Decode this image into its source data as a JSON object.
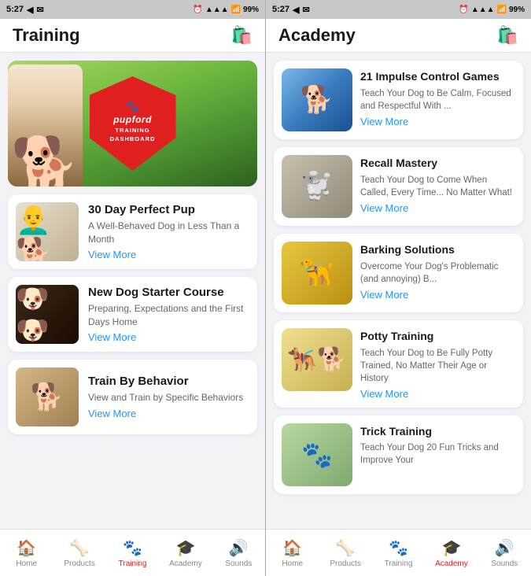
{
  "leftScreen": {
    "statusBar": {
      "time": "5:27",
      "battery": "99%"
    },
    "header": {
      "title": "Training",
      "icon": "bag"
    },
    "courses": [
      {
        "id": "30day",
        "title": "30 Day Perfect Pup",
        "desc": "A Well-Behaved Dog in Less Than a Month",
        "viewMore": "View More",
        "thumbType": "30day"
      },
      {
        "id": "newdog",
        "title": "New Dog Starter Course",
        "desc": "Preparing, Expectations and the First Days Home",
        "viewMore": "View More",
        "thumbType": "newdog"
      },
      {
        "id": "behavior",
        "title": "Train By Behavior",
        "desc": "View and Train by Specific Behaviors",
        "viewMore": "View More",
        "thumbType": "behavior"
      }
    ],
    "nav": [
      {
        "id": "home",
        "label": "Home",
        "icon": "🏠",
        "active": false
      },
      {
        "id": "products",
        "label": "Products",
        "icon": "🦴",
        "active": false
      },
      {
        "id": "training",
        "label": "Training",
        "icon": "🐾",
        "active": true
      },
      {
        "id": "academy",
        "label": "Academy",
        "icon": "🎓",
        "active": false
      },
      {
        "id": "sounds",
        "label": "Sounds",
        "icon": "🔊",
        "active": false
      }
    ],
    "shield": {
      "brand": "pupford",
      "line1": "TRAINING",
      "line2": "DASHBOARD"
    }
  },
  "rightScreen": {
    "statusBar": {
      "time": "5:27",
      "battery": "99%"
    },
    "header": {
      "title": "Academy",
      "icon": "bag"
    },
    "courses": [
      {
        "id": "impulse",
        "title": "21 Impulse Control Games",
        "desc": "Teach Your Dog to Be Calm, Focused and Respectful With ...",
        "viewMore": "View More",
        "thumbType": "impulse"
      },
      {
        "id": "recall",
        "title": "Recall Mastery",
        "desc": "Teach Your Dog to Come When Called, Every Time... No Matter What!",
        "viewMore": "View More",
        "thumbType": "recall"
      },
      {
        "id": "barking",
        "title": "Barking Solutions",
        "desc": "Overcome Your Dog's Problematic (and annoying) B...",
        "viewMore": "View More",
        "thumbType": "barking"
      },
      {
        "id": "potty",
        "title": "Potty Training",
        "desc": "Teach Your Dog to Be Fully Potty Trained, No Matter Their Age or History",
        "viewMore": "View More",
        "thumbType": "potty"
      },
      {
        "id": "trick",
        "title": "Trick Training",
        "desc": "Teach Your Dog 20 Fun Tricks and Improve Your",
        "viewMore": "View More",
        "thumbType": "trick"
      }
    ],
    "nav": [
      {
        "id": "home",
        "label": "Home",
        "icon": "🏠",
        "active": false
      },
      {
        "id": "products",
        "label": "Products",
        "icon": "🦴",
        "active": false
      },
      {
        "id": "training",
        "label": "Training",
        "icon": "🐾",
        "active": false
      },
      {
        "id": "academy",
        "label": "Academy",
        "icon": "🎓",
        "active": true
      },
      {
        "id": "sounds",
        "label": "Sounds",
        "icon": "🔊",
        "active": false
      }
    ]
  }
}
